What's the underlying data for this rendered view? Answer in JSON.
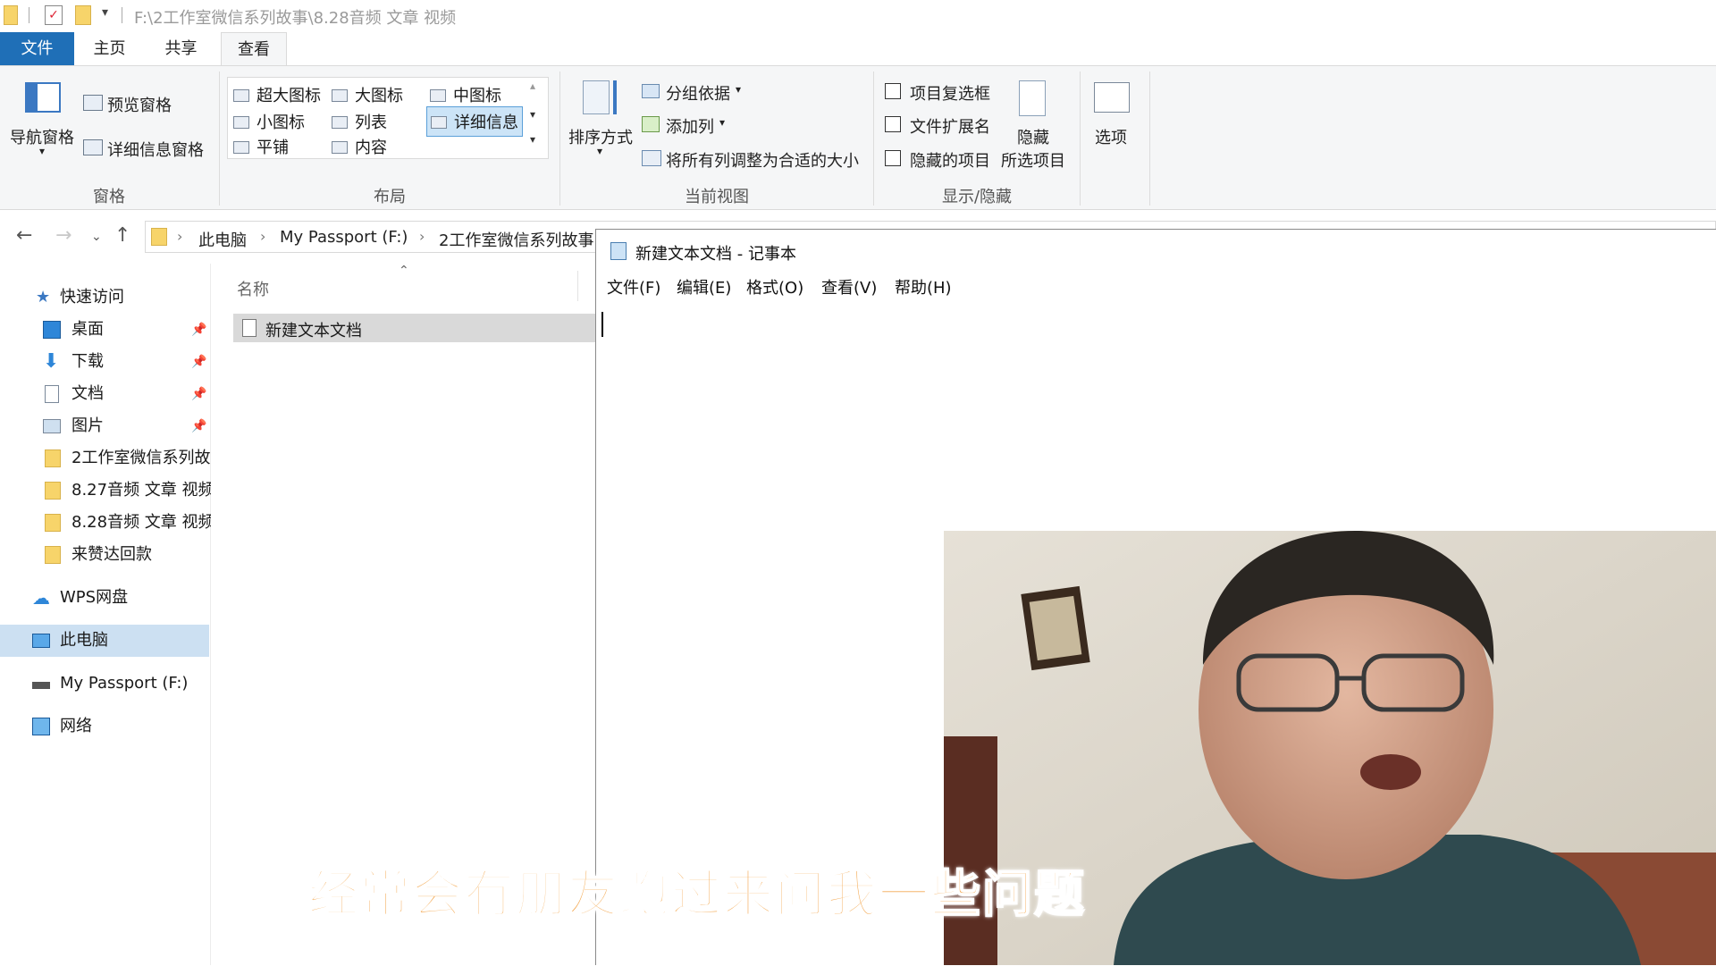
{
  "window": {
    "title_path": "F:\\2工作室微信系列故事\\8.28音频 文章 视频"
  },
  "ribbon_tabs": [
    "文件",
    "主页",
    "共享",
    "查看"
  ],
  "ribbon": {
    "panes": {
      "title": "窗格",
      "nav_pane": "导航窗格",
      "preview_pane": "预览窗格",
      "details_pane": "详细信息窗格"
    },
    "layout": {
      "title": "布局",
      "items": [
        "超大图标",
        "大图标",
        "中图标",
        "小图标",
        "列表",
        "详细信息",
        "平铺",
        "内容"
      ]
    },
    "current_view": {
      "title": "当前视图",
      "sort_by": "排序方式",
      "group_by": "分组依据",
      "add_columns": "添加列",
      "size_all_columns": "将所有列调整为合适的大小"
    },
    "show_hide": {
      "title": "显示/隐藏",
      "item_checkboxes": "项目复选框",
      "file_extensions": "文件扩展名",
      "hidden_items": "隐藏的项目",
      "hide_selected_line1": "隐藏",
      "hide_selected_line2": "所选项目"
    },
    "options": "选项"
  },
  "address": {
    "crumbs": [
      "此电脑",
      "My Passport (F:)",
      "2工作室微信系列故事"
    ]
  },
  "sidebar": {
    "quick_access": "快速访问",
    "items": [
      {
        "label": "桌面",
        "icon": "desktop-icon",
        "pinned": true
      },
      {
        "label": "下载",
        "icon": "download-icon",
        "pinned": true
      },
      {
        "label": "文档",
        "icon": "document-icon",
        "pinned": true
      },
      {
        "label": "图片",
        "icon": "picture-icon",
        "pinned": true
      },
      {
        "label": "2工作室微信系列故",
        "icon": "folder-icon",
        "pinned": false
      },
      {
        "label": "8.27音频 文章 视频",
        "icon": "folder-icon",
        "pinned": false
      },
      {
        "label": "8.28音频 文章 视频",
        "icon": "folder-icon",
        "pinned": false
      },
      {
        "label": "来赞达回款",
        "icon": "folder-icon",
        "pinned": false
      }
    ],
    "wps": "WPS网盘",
    "this_pc": "此电脑",
    "drive": "My Passport (F:)",
    "network": "网络"
  },
  "file_list": {
    "column_name": "名称",
    "files": [
      "新建文本文档"
    ]
  },
  "notepad": {
    "title": "新建文本文档 - 记事本",
    "menu": [
      "文件(F)",
      "编辑(E)",
      "格式(O)",
      "查看(V)",
      "帮助(H)"
    ]
  },
  "subtitle": "经常会有朋友跑过来问我一些问题",
  "colors": {
    "file_tab_bg": "#1f6fb7",
    "selection_bg": "#cce0f2",
    "subtitle": "#f3a54a"
  }
}
